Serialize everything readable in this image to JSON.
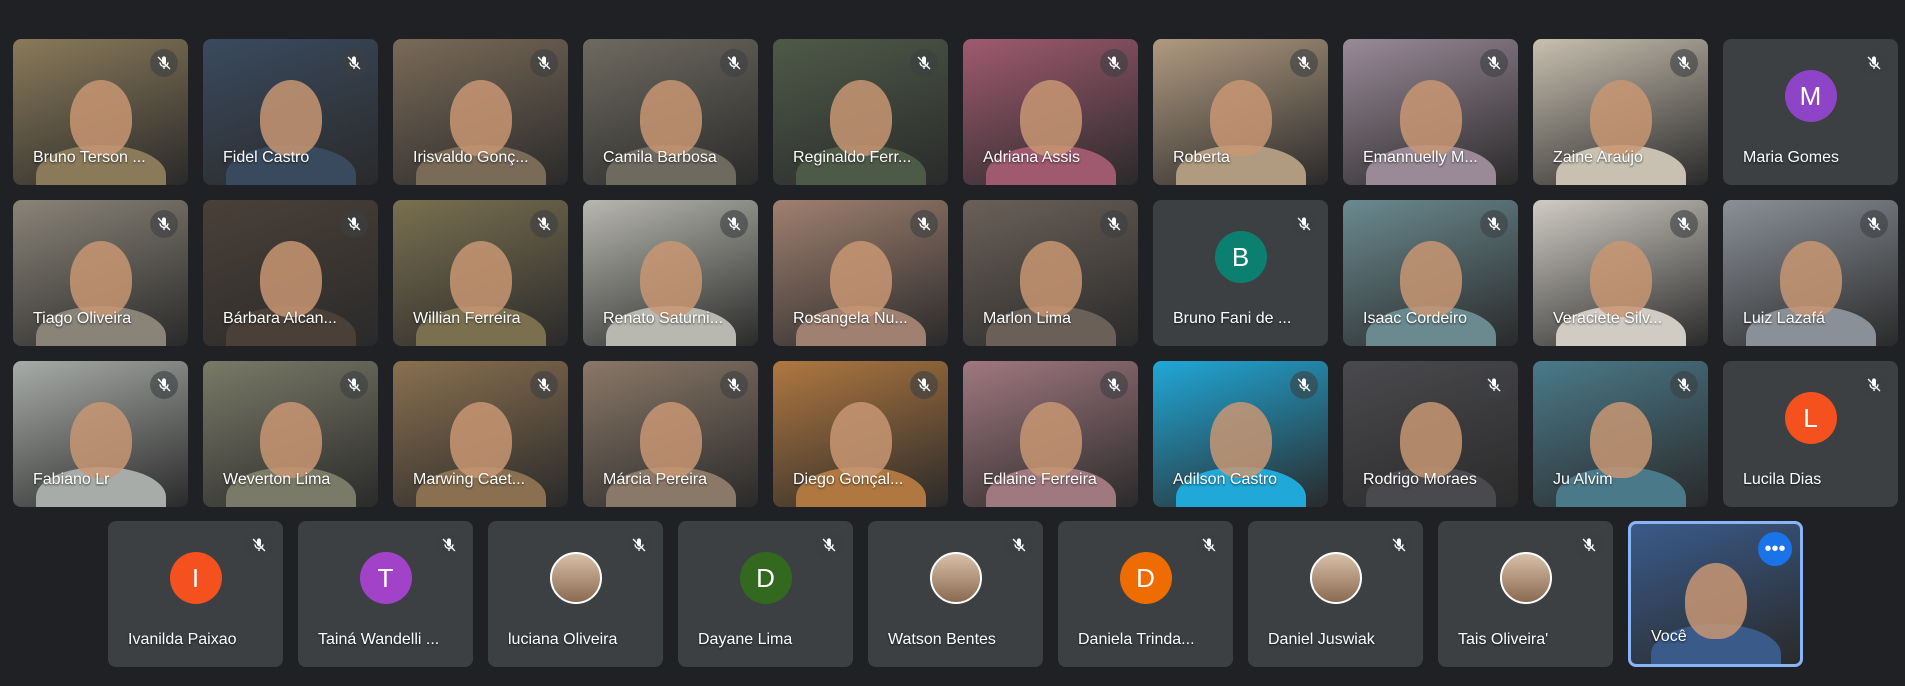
{
  "colors": {
    "background": "#202124",
    "tile": "#3c4043",
    "self_border": "#8ab4f8",
    "more_button": "#1a73e8"
  },
  "mic_icon": "mic-off-icon",
  "grid": [
    {
      "name": "Bruno Terson ...",
      "bg": "#8a7a5a"
    },
    {
      "name": "Fidel Castro",
      "bg": "#3a4a5e"
    },
    {
      "name": "Irisvaldo Gonç...",
      "bg": "#7a6a58"
    },
    {
      "name": "Camila Barbosa",
      "bg": "#6e6a60"
    },
    {
      "name": "Reginaldo Ferr...",
      "bg": "#4e5a48"
    },
    {
      "name": "Adriana Assis",
      "bg": "#a05a70"
    },
    {
      "name": "Roberta",
      "bg": "#b09a80"
    },
    {
      "name": "Emannuelly M...",
      "bg": "#9a8a98"
    },
    {
      "name": "Zaine Araújo",
      "bg": "#c8c0b0"
    },
    {
      "name": "Maria Gomes",
      "avatar": "M",
      "avatar_color": "#8e44c6"
    },
    {
      "name": "Tiago Oliveira",
      "bg": "#8a8478"
    },
    {
      "name": "Bárbara Alcan...",
      "bg": "#4a4038"
    },
    {
      "name": "Willian Ferreira",
      "bg": "#7a7050"
    },
    {
      "name": "Renato Saturni...",
      "bg": "#b8b8b0"
    },
    {
      "name": "Rosangela Nu...",
      "bg": "#a08070"
    },
    {
      "name": "Marlon Lima",
      "bg": "#6a6058"
    },
    {
      "name": "Bruno Fani de ...",
      "avatar": "B",
      "avatar_color": "#0b8070"
    },
    {
      "name": "Isaac Cordeiro",
      "bg": "#6a8a90"
    },
    {
      "name": "Veraciete Silv...",
      "bg": "#d0ccc4"
    },
    {
      "name": "Luiz Lazafá",
      "bg": "#8a9098"
    },
    {
      "name": "Fabiano Lr",
      "bg": "#a8aca8"
    },
    {
      "name": "Weverton Lima",
      "bg": "#7a7a68"
    },
    {
      "name": "Marwing Caet...",
      "bg": "#8a7050"
    },
    {
      "name": "Márcia Pereira",
      "bg": "#8a7868"
    },
    {
      "name": "Diego Gonçal...",
      "bg": "#b07840"
    },
    {
      "name": "Edlaine Ferreira",
      "bg": "#a07880"
    },
    {
      "name": "Adilson Castro",
      "bg": "#20a8d8"
    },
    {
      "name": "Rodrigo Moraes",
      "bg": "#4a4a4e"
    },
    {
      "name": "Ju Alvim",
      "bg": "#4a7a8a"
    },
    {
      "name": "Lucila Dias",
      "avatar": "L",
      "avatar_color": "#f4511e"
    }
  ],
  "bottom": [
    {
      "name": "Ivanilda Paixao",
      "avatar": "I",
      "avatar_color": "#f4511e"
    },
    {
      "name": "Tainá Wandelli ...",
      "avatar": "T",
      "avatar_color": "#a142c8"
    },
    {
      "name": "luciana Oliveira",
      "photo": true
    },
    {
      "name": "Dayane Lima",
      "avatar": "D",
      "avatar_color": "#33691e"
    },
    {
      "name": "Watson Bentes",
      "photo": true
    },
    {
      "name": "Daniela Trinda...",
      "avatar": "D",
      "avatar_color": "#ef6c00"
    },
    {
      "name": "Daniel Juswiak",
      "photo": true
    },
    {
      "name": "Tais Oliveira'",
      "photo": true
    },
    {
      "name": "Você",
      "bg": "#3a5a8a",
      "self": true,
      "more_label": "•••"
    }
  ]
}
